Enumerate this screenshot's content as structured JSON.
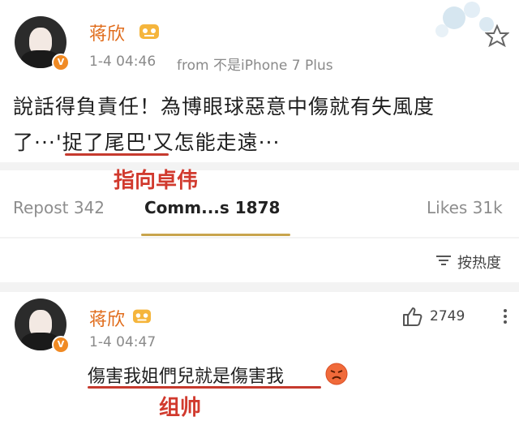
{
  "post": {
    "author": "蒋欣",
    "timestamp": "1-4 04:46",
    "source": "from 不是iPhone 7 Plus",
    "text_line1": "說話得負責任！為博眼球惡意中傷就有失風度",
    "text_line2_prefix": "了···",
    "text_line2_highlight": "'捉了尾巴'",
    "text_line2_suffix": "又怎能走遠···",
    "annotation": "指向卓伟",
    "stats": {
      "repost": "Repost 342",
      "comments": "Comm...s 1878",
      "likes": "Likes 31k"
    }
  },
  "sort": {
    "label": "按热度"
  },
  "comment": {
    "author": "蒋欣",
    "timestamp": "1-4 04:47",
    "text": "傷害我姐們兒就是傷害我",
    "likes": "2749",
    "annotation_partial": "组帅"
  },
  "colors": {
    "author_name": "#e06b1a",
    "underline_red": "#c63a2e",
    "annotation_red": "#d13a2e",
    "tab_underline": "#c8a44d"
  }
}
